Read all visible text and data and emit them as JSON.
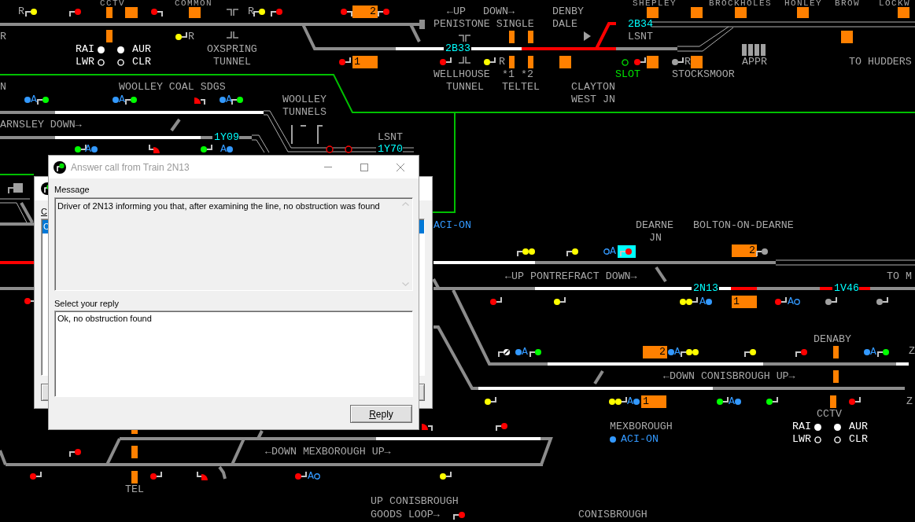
{
  "labels": [
    {
      "text": "CCTV",
      "color": "#a8a8a8"
    },
    {
      "text": "COMMON",
      "color": "#a8a8a8"
    },
    {
      "text": "SHEPLEY",
      "color": "#a8a8a8"
    },
    {
      "text": "BROCKHOLES",
      "color": "#a8a8a8"
    },
    {
      "text": "HONLEY",
      "color": "#a8a8a8"
    },
    {
      "text": "BROW",
      "color": "#a8a8a8"
    },
    {
      "text": "LOCKW",
      "color": "#a8a8a8"
    },
    {
      "text": "R",
      "color": "#a8a8a8"
    },
    {
      "text": "R",
      "color": "#a8a8a8"
    },
    {
      "text": "←UP",
      "color": "#a8a8a8"
    },
    {
      "text": "DOWN→",
      "color": "#a8a8a8"
    },
    {
      "text": "DENBY",
      "color": "#a8a8a8"
    },
    {
      "text": "PENISTONE SINGLE",
      "color": "#a8a8a8"
    },
    {
      "text": "DALE",
      "color": "#a8a8a8"
    },
    {
      "text": "R",
      "color": "#a8a8a8"
    },
    {
      "text": "R",
      "color": "#a8a8a8"
    },
    {
      "text": "LSNT",
      "color": "#a8a8a8"
    },
    {
      "text": "OXSPRING",
      "color": "#a8a8a8"
    },
    {
      "text": "TUNNEL",
      "color": "#a8a8a8"
    },
    {
      "text": "R",
      "color": "#a8a8a8"
    },
    {
      "text": "R",
      "color": "#a8a8a8"
    },
    {
      "text": "APPR",
      "color": "#a8a8a8"
    },
    {
      "text": "TO HUDDERS",
      "color": "#a8a8a8"
    },
    {
      "text": "WELLHOUSE",
      "color": "#a8a8a8"
    },
    {
      "text": "*1",
      "color": "#a8a8a8"
    },
    {
      "text": "*2",
      "color": "#a8a8a8"
    },
    {
      "text": "SLOT",
      "color": "#00e000"
    },
    {
      "text": "STOCKSMOOR",
      "color": "#a8a8a8"
    },
    {
      "text": "N",
      "color": "#a8a8a8"
    },
    {
      "text": "WOOLLEY COAL SDGS",
      "color": "#a8a8a8"
    },
    {
      "text": "TUNNEL",
      "color": "#a8a8a8"
    },
    {
      "text": "TEL",
      "color": "#a8a8a8"
    },
    {
      "text": "TEL",
      "color": "#a8a8a8"
    },
    {
      "text": "CLAYTON",
      "color": "#a8a8a8"
    },
    {
      "text": "WOOLLEY",
      "color": "#a8a8a8"
    },
    {
      "text": "WEST JN",
      "color": "#a8a8a8"
    },
    {
      "text": "TUNNELS",
      "color": "#a8a8a8"
    },
    {
      "text": "ARNSLEY DOWN→",
      "color": "#a8a8a8"
    },
    {
      "text": "LSNT",
      "color": "#a8a8a8"
    },
    {
      "text": "ACI-ON",
      "color": "#3399ff"
    },
    {
      "text": "DEARNE",
      "color": "#a8a8a8"
    },
    {
      "text": "BOLTON-ON-DEARNE",
      "color": "#a8a8a8"
    },
    {
      "text": "JN",
      "color": "#a8a8a8"
    },
    {
      "text": "←UP PONTREFRACT DOWN→",
      "color": "#a8a8a8"
    },
    {
      "text": "TO M",
      "color": "#a8a8a8"
    },
    {
      "text": "DENABY",
      "color": "#a8a8a8"
    },
    {
      "text": "Z",
      "color": "#a8a8a8"
    },
    {
      "text": "←DOWN CONISBROUGH UP→",
      "color": "#a8a8a8"
    },
    {
      "text": "Z",
      "color": "#a8a8a8"
    },
    {
      "text": "CCTV",
      "color": "#a8a8a8"
    },
    {
      "text": "MEXBOROUGH",
      "color": "#a8a8a8"
    },
    {
      "text": "←DOWN MEXBOROUGH UP→",
      "color": "#a8a8a8"
    },
    {
      "text": "TEL",
      "color": "#a8a8a8"
    },
    {
      "text": "UP CONISBROUGH",
      "color": "#a8a8a8"
    },
    {
      "text": "GOODS LOOP→",
      "color": "#a8a8a8"
    },
    {
      "text": "CONISBROUGH",
      "color": "#a8a8a8"
    }
  ],
  "train_descriptions": [
    "2B34",
    "2B33",
    "1Y09",
    "1Y70",
    "2N13",
    "1V46"
  ],
  "berths": [
    {
      "number": "2"
    },
    {
      "number": "1"
    },
    {
      "number": "2"
    },
    {
      "number": "1"
    },
    {
      "number": "2"
    },
    {
      "number": "1"
    }
  ],
  "tracks": [
    {
      "route_set": false,
      "occupied": false
    },
    {
      "route_set": false,
      "occupied": false
    },
    {
      "route_set": false,
      "occupied": false
    },
    {
      "route_set": true,
      "occupied": false
    },
    {
      "route_set": true,
      "occupied": false
    },
    {
      "route_set": false,
      "occupied": true
    },
    {
      "route_set": false,
      "occupied": true
    },
    {
      "route_set": false,
      "occupied": false
    },
    {
      "route_set": false,
      "occupied": false
    },
    {
      "route_set": true,
      "occupied": false
    },
    {
      "route_set": false,
      "occupied": false
    },
    {
      "route_set": false,
      "occupied": false
    },
    {
      "route_set": true,
      "occupied": false
    },
    {
      "route_set": false,
      "occupied": false
    },
    {
      "route_set": false,
      "occupied": false
    },
    {
      "route_set": false,
      "occupied": false
    },
    {
      "route_set": false,
      "occupied": true
    },
    {
      "route_set": false,
      "occupied": false
    },
    {
      "route_set": true,
      "occupied": false
    },
    {
      "route_set": false,
      "occupied": false
    },
    {
      "route_set": false,
      "occupied": false
    },
    {
      "route_set": false,
      "occupied": false
    },
    {
      "route_set": true,
      "occupied": false
    },
    {
      "route_set": true,
      "occupied": false
    },
    {
      "route_set": false,
      "occupied": true
    },
    {
      "route_set": false,
      "occupied": false
    },
    {
      "route_set": false,
      "occupied": true
    },
    {
      "route_set": false,
      "occupied": true
    },
    {
      "route_set": false,
      "occupied": false
    },
    {
      "route_set": false,
      "occupied": false
    },
    {
      "route_set": false,
      "occupied": false
    },
    {
      "route_set": true,
      "occupied": false
    },
    {
      "route_set": false,
      "occupied": false
    },
    {
      "route_set": true,
      "occupied": false
    },
    {
      "route_set": false,
      "occupied": false
    },
    {
      "route_set": true,
      "occupied": false
    },
    {
      "route_set": false,
      "occupied": false
    },
    {
      "route_set": false,
      "occupied": false
    },
    {
      "route_set": false,
      "occupied": false
    },
    {
      "route_set": true,
      "occupied": false
    },
    {
      "route_set": false,
      "occupied": false
    },
    {
      "route_set": false,
      "occupied": false
    },
    {
      "route_set": false,
      "occupied": false
    },
    {
      "route_set": false,
      "occupied": false
    },
    {
      "route_set": false,
      "occupied": false
    },
    {
      "route_set": false,
      "occupied": false
    },
    {
      "route_set": false,
      "occupied": false
    },
    {
      "route_set": false,
      "occupied": false
    }
  ],
  "signals": [
    {
      "color": "#ffff00",
      "kind": "main",
      "selected": false
    },
    {
      "color": "#ff0000",
      "kind": "main",
      "selected": false
    },
    {
      "color": "#ff0000",
      "kind": "main",
      "selected": false
    },
    {
      "color": "#ffff00",
      "kind": "main",
      "selected": false
    },
    {
      "color": "#ff0000",
      "kind": "main",
      "selected": false
    },
    {
      "color": "#ff0000",
      "kind": "main",
      "selected": false
    },
    {
      "color": "#ff0000",
      "kind": "main",
      "selected": false
    },
    {
      "color": "#ffff00",
      "kind": "main",
      "selected": false
    },
    {
      "color": "#ff0000",
      "kind": "main",
      "selected": false
    },
    {
      "color": "#ff0000",
      "kind": "main",
      "selected": false
    },
    {
      "color": "#ffff00",
      "kind": "main",
      "selected": false
    },
    {
      "color": "#ff0000",
      "kind": "main",
      "selected": false
    },
    {
      "color": "#a0a0a0",
      "kind": "main",
      "selected": false
    },
    {
      "color": "#00ff00",
      "kind": "main",
      "selected": false
    },
    {
      "color": "#00ff00",
      "kind": "main",
      "selected": false
    },
    {
      "color": "#ff0000",
      "kind": "shunt",
      "selected": false
    },
    {
      "color": "#00ff00",
      "kind": "main",
      "selected": false
    },
    {
      "color": "#00ff00",
      "kind": "main",
      "selected": false
    },
    {
      "color": "#ff0000",
      "kind": "shunt",
      "selected": false
    },
    {
      "color": "#00ff00",
      "kind": "main",
      "selected": false
    },
    {
      "color": "#ffff00",
      "kind": "double",
      "selected": false
    },
    {
      "color": "#ffff00",
      "kind": "main",
      "selected": false
    },
    {
      "color": "#ff0000",
      "kind": "main",
      "selected": true
    },
    {
      "color": "#a0a0a0",
      "kind": "main",
      "selected": false
    },
    {
      "color": "#ff0000",
      "kind": "main",
      "selected": false
    },
    {
      "color": "#ff0000",
      "kind": "main",
      "selected": false
    },
    {
      "color": "#ffff00",
      "kind": "main",
      "selected": false
    },
    {
      "color": "#ffff00",
      "kind": "double",
      "selected": false
    },
    {
      "color": "#ff0000",
      "kind": "main",
      "selected": false
    },
    {
      "color": "#a0a0a0",
      "kind": "main",
      "selected": false
    },
    {
      "color": "#a0a0a0",
      "kind": "main",
      "selected": false
    },
    {
      "color": "#ffffff",
      "kind": "hatched",
      "selected": false
    },
    {
      "color": "#00ff00",
      "kind": "main",
      "selected": false
    },
    {
      "color": "#ffff00",
      "kind": "double",
      "selected": false
    },
    {
      "color": "#ffff00",
      "kind": "main",
      "selected": false
    },
    {
      "color": "#ff0000",
      "kind": "main",
      "selected": false
    },
    {
      "color": "#00ff00",
      "kind": "main",
      "selected": false
    },
    {
      "color": "#ffff00",
      "kind": "main",
      "selected": false
    },
    {
      "color": "#ffff00",
      "kind": "double",
      "selected": false
    },
    {
      "color": "#00ff00",
      "kind": "main",
      "selected": false
    },
    {
      "color": "#00ff00",
      "kind": "main",
      "selected": false
    },
    {
      "color": "#ff0000",
      "kind": "main",
      "selected": false
    },
    {
      "color": "#ff0000",
      "kind": "shunt",
      "selected": false
    },
    {
      "color": "#ff0000",
      "kind": "main",
      "selected": false
    },
    {
      "color": "#ff0000",
      "kind": "main",
      "selected": false
    },
    {
      "color": "#ff0000",
      "kind": "main",
      "selected": false
    },
    {
      "color": "#ff0000",
      "kind": "main",
      "selected": false
    },
    {
      "color": "#ff0000",
      "kind": "shunt",
      "selected": false
    },
    {
      "color": "#ff0000",
      "kind": "main",
      "selected": false
    },
    {
      "color": "#ffff00",
      "kind": "main",
      "selected": false
    },
    {
      "color": "#ff0000",
      "kind": "main",
      "selected": false
    }
  ],
  "ars_markers": [
    {
      "text": "A",
      "filled": true
    },
    {
      "text": "A",
      "filled": true
    },
    {
      "text": "A",
      "filled": true
    },
    {
      "text": "A",
      "filled": true
    },
    {
      "text": "A",
      "filled": true
    },
    {
      "text": "A",
      "filled": false
    },
    {
      "text": "A",
      "filled": true
    },
    {
      "text": "A",
      "filled": false
    },
    {
      "text": "A",
      "filled": true
    },
    {
      "text": "A",
      "filled": true
    },
    {
      "text": "A",
      "filled": true
    },
    {
      "text": "A",
      "filled": true
    },
    {
      "text": "A",
      "filled": true
    },
    {
      "text": "A",
      "filled": false
    }
  ],
  "cctv_panels": [
    {
      "rows": [
        {
          "left": "RAI",
          "left_lit": true,
          "right": "AUR",
          "right_lit": true
        },
        {
          "left": "LWR",
          "left_lit": false,
          "right": "CLR",
          "right_lit": false
        }
      ]
    },
    {
      "rows": [
        {
          "left": "RAI",
          "left_lit": true,
          "right": "AUR",
          "right_lit": true
        },
        {
          "left": "LWR",
          "left_lit": false,
          "right": "CLR",
          "right_lit": false
        }
      ]
    }
  ],
  "slot_indicator": {
    "lit": false
  },
  "aci_indicators": [
    {
      "label": "ACI-ON",
      "lit": true
    }
  ],
  "windows": [
    {
      "kind": "calls",
      "label": "C",
      "items": [
        {
          "text": "C",
          "selected": true
        }
      ]
    },
    {
      "kind": "answer",
      "title": "Answer call from Train 2N13",
      "active": false,
      "message_label": "Message",
      "message": "Driver of 2N13 informing you that, after examining the line, no obstruction was found",
      "reply_label": "Select your reply",
      "replies": [
        {
          "text": "Ok, no obstruction found",
          "selected": false
        }
      ],
      "button": "Reply"
    }
  ]
}
